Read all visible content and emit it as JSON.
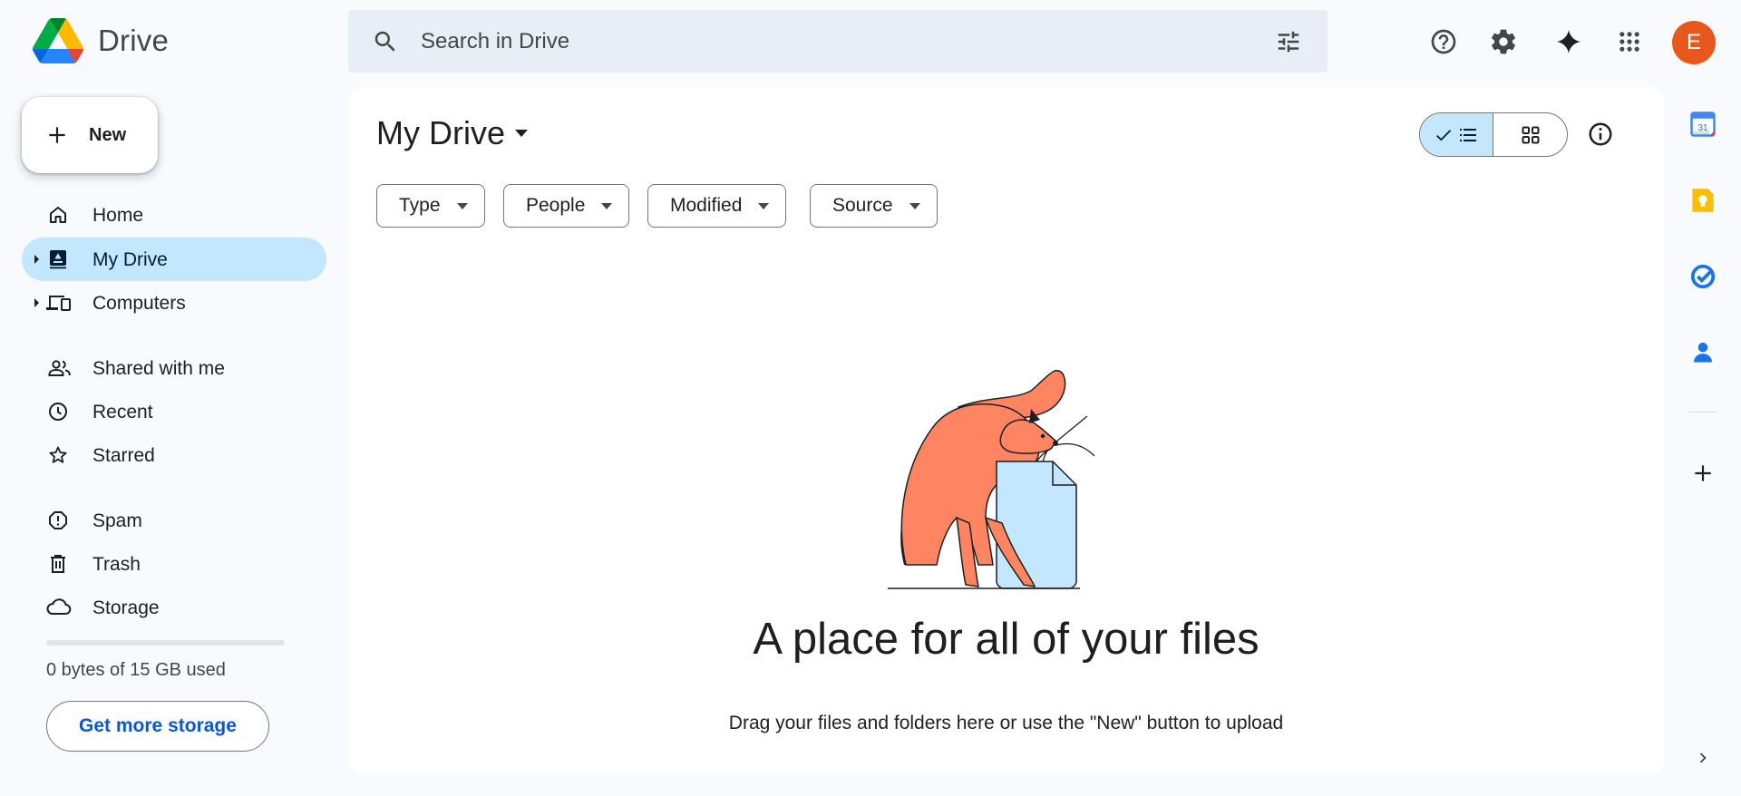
{
  "app": {
    "name": "Drive"
  },
  "search": {
    "placeholder": "Search in Drive"
  },
  "header": {
    "avatar_initial": "E",
    "avatar_color": "#e8571c"
  },
  "sidebar": {
    "new_label": "New",
    "items": [
      {
        "label": "Home",
        "icon": "home-icon"
      },
      {
        "label": "My Drive",
        "icon": "my-drive-icon",
        "active": true
      },
      {
        "label": "Computers",
        "icon": "computers-icon"
      },
      {
        "label": "Shared with me",
        "icon": "shared-icon"
      },
      {
        "label": "Recent",
        "icon": "clock-icon"
      },
      {
        "label": "Starred",
        "icon": "star-icon"
      },
      {
        "label": "Spam",
        "icon": "spam-icon"
      },
      {
        "label": "Trash",
        "icon": "trash-icon"
      },
      {
        "label": "Storage",
        "icon": "cloud-icon"
      }
    ],
    "storage": {
      "used_text": "0 bytes of 15 GB used",
      "used_fraction": 0,
      "button_label": "Get more storage"
    }
  },
  "main": {
    "title": "My Drive",
    "filters": [
      "Type",
      "People",
      "Modified",
      "Source"
    ],
    "view": "list",
    "empty": {
      "title": "A place for all of your files",
      "subtitle": "Drag your files and folders here or use the \"New\" button to upload"
    }
  },
  "colors": {
    "accent": "#0b57d0",
    "active_bg": "#c2e7ff",
    "search_bg": "#e9eef6",
    "cat": "#ff8562",
    "file": "#c2e7ff"
  }
}
